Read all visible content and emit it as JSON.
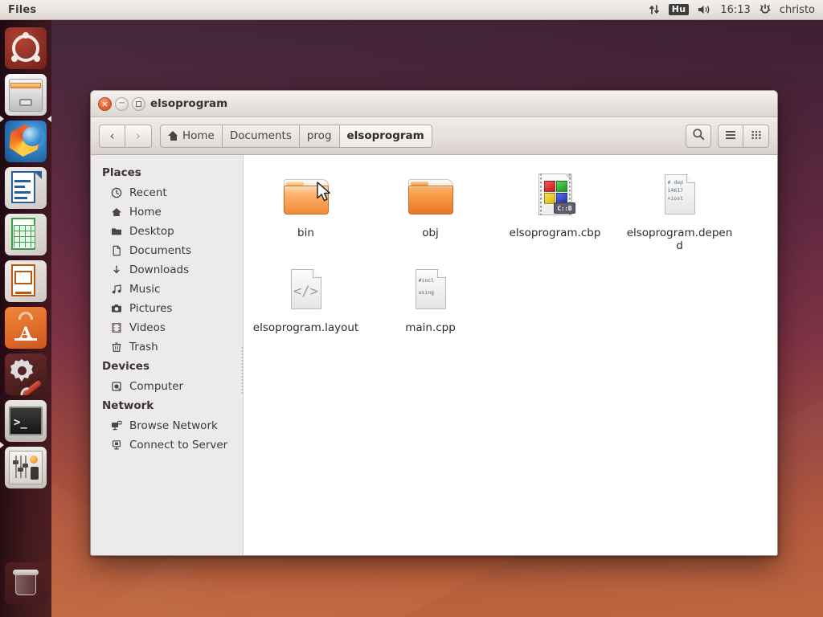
{
  "panel": {
    "title": "Files",
    "indicators": {
      "network_icon": "network-transfer-icon",
      "keyboard_layout": "Hu",
      "volume_icon": "volume-icon",
      "clock": "16:13",
      "session_icon": "power-gear-icon",
      "user": "christo"
    }
  },
  "launcher": {
    "items": [
      {
        "name": "ubuntu-dash",
        "label": "Dash home",
        "running": false
      },
      {
        "name": "files",
        "label": "Files",
        "running": true,
        "focused": true
      },
      {
        "name": "firefox",
        "label": "Firefox Web Browser",
        "running": false
      },
      {
        "name": "libreoffice-writer",
        "label": "LibreOffice Writer",
        "running": false
      },
      {
        "name": "libreoffice-calc",
        "label": "LibreOffice Calc",
        "running": false
      },
      {
        "name": "libreoffice-impress",
        "label": "LibreOffice Impress",
        "running": false
      },
      {
        "name": "software-center",
        "label": "Ubuntu Software Center",
        "running": false
      },
      {
        "name": "system-settings",
        "label": "System Settings",
        "running": false
      },
      {
        "name": "terminal",
        "label": "Terminal",
        "running": true,
        "focused": false
      },
      {
        "name": "audio-mixer",
        "label": "Audio Mixer",
        "running": false
      },
      {
        "name": "trash",
        "label": "Trash",
        "running": false
      }
    ]
  },
  "window": {
    "title": "elsoprogram",
    "buttons": {
      "close": "×",
      "minimize": "−",
      "maximize": "maximize"
    },
    "toolbar": {
      "back": "‹",
      "forward": "›",
      "search_icon": "search-icon",
      "menu_icon": "list-view-icon",
      "grid_icon": "grid-view-icon"
    },
    "breadcrumb": [
      {
        "label": "Home",
        "icon": "home-icon",
        "active": false
      },
      {
        "label": "Documents",
        "active": false
      },
      {
        "label": "prog",
        "active": false
      },
      {
        "label": "elsoprogram",
        "active": true
      }
    ],
    "sidebar": [
      {
        "type": "header",
        "label": "Places"
      },
      {
        "type": "item",
        "label": "Recent",
        "icon": "clock-icon",
        "glyph": "◴"
      },
      {
        "type": "item",
        "label": "Home",
        "icon": "home-icon",
        "glyph": "⌂"
      },
      {
        "type": "item",
        "label": "Desktop",
        "icon": "folder-icon",
        "glyph": "▬"
      },
      {
        "type": "item",
        "label": "Documents",
        "icon": "document-icon",
        "glyph": "□"
      },
      {
        "type": "item",
        "label": "Downloads",
        "icon": "download-icon",
        "glyph": "⇣"
      },
      {
        "type": "item",
        "label": "Music",
        "icon": "music-note-icon",
        "glyph": "♫"
      },
      {
        "type": "item",
        "label": "Pictures",
        "icon": "camera-icon",
        "glyph": "◉"
      },
      {
        "type": "item",
        "label": "Videos",
        "icon": "film-icon",
        "glyph": "☰"
      },
      {
        "type": "item",
        "label": "Trash",
        "icon": "trash-icon",
        "glyph": "Ὕ1"
      },
      {
        "type": "header",
        "label": "Devices"
      },
      {
        "type": "item",
        "label": "Computer",
        "icon": "computer-icon",
        "glyph": "▣"
      },
      {
        "type": "header",
        "label": "Network"
      },
      {
        "type": "item",
        "label": "Browse Network",
        "icon": "network-icon",
        "glyph": "⌗"
      },
      {
        "type": "item",
        "label": "Connect to Server",
        "icon": "server-icon",
        "glyph": "▭"
      }
    ],
    "files": [
      {
        "name": "bin",
        "kind": "folder",
        "hovered": true
      },
      {
        "name": "obj",
        "kind": "folder",
        "hovered": false
      },
      {
        "name": "elsoprogram.cbp",
        "kind": "codeblocks-project",
        "badge": "C::B"
      },
      {
        "name": "elsoprogram.depend",
        "kind": "text-document",
        "preview": [
          "# dep",
          "14617",
          "<iost"
        ]
      },
      {
        "name": "elsoprogram.layout",
        "kind": "xml-document",
        "glyph": "</>"
      },
      {
        "name": "main.cpp",
        "kind": "source-document",
        "preview": [
          "#incl",
          "using"
        ]
      }
    ]
  },
  "colors": {
    "ubuntu_orange": "#e8762a",
    "close_button": "#e2683a",
    "panel_background": "#e9e4e1",
    "sidebar_background": "#eceaea",
    "wallpaper_top": "#3d1f33",
    "wallpaper_bottom": "#c2683f"
  }
}
